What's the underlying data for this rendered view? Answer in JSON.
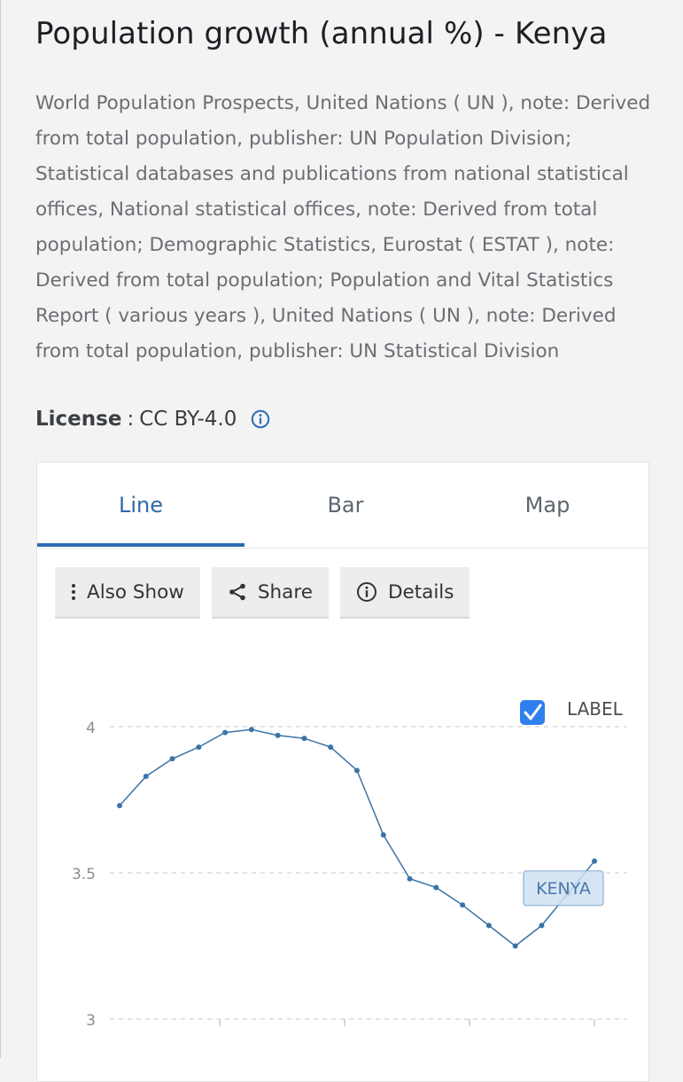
{
  "page": {
    "title": "Population growth (annual %) - Kenya",
    "source": "World Population Prospects, United Nations ( UN ), note: Derived from total population, publisher: UN Population Division; Statistical databases and publications from national statistical offices, National statistical offices, note: Derived from total population; Demographic Statistics, Eurostat ( ESTAT ), note: Derived from total population; Population and Vital Statistics Report ( various years ), United Nations ( UN ), note: Derived from total population, publisher: UN Statistical Division",
    "license_label": "License",
    "license_sep": ":",
    "license_value": "CC BY-4.0"
  },
  "tabs": [
    {
      "label": "Line",
      "active": true
    },
    {
      "label": "Bar",
      "active": false
    },
    {
      "label": "Map",
      "active": false
    }
  ],
  "toolbar": {
    "also_show": "Also Show",
    "share": "Share",
    "details": "Details"
  },
  "colors": {
    "accent": "#2e6bb2",
    "line": "#3b73a8",
    "checkbox": "#2f80ed",
    "series_label_bg": "#cfe0f1",
    "grid": "#d0d3d6"
  },
  "chart_data": {
    "type": "line",
    "ylim": [
      3,
      4
    ],
    "yticks": [
      {
        "value": 4,
        "label": "4"
      },
      {
        "value": 3.5,
        "label": "3.5"
      },
      {
        "value": 3,
        "label": "3"
      }
    ],
    "grid": "horizontal-dashed",
    "label_toggle": {
      "text": "LABEL",
      "checked": true
    },
    "series": [
      {
        "name": "KENYA",
        "values": [
          3.73,
          3.83,
          3.89,
          3.93,
          3.98,
          3.99,
          3.97,
          3.96,
          3.93,
          3.85,
          3.63,
          3.48,
          3.45,
          3.39,
          3.32,
          3.25,
          3.32,
          3.43,
          3.54
        ]
      }
    ]
  }
}
